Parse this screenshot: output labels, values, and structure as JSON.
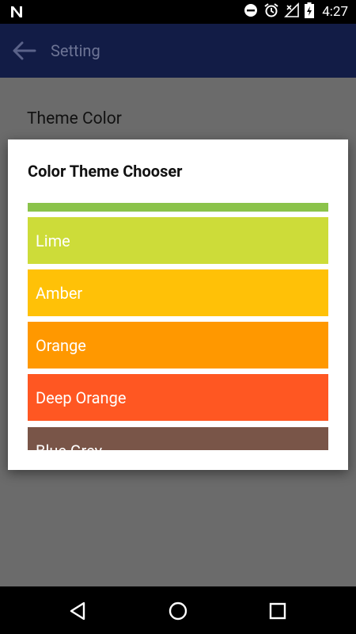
{
  "status_bar": {
    "time": "4:27",
    "icons": [
      "n-notification-icon",
      "do-not-disturb-icon",
      "alarm-icon",
      "signal-icon",
      "battery-charging-icon"
    ]
  },
  "toolbar": {
    "title": "Setting",
    "back_icon": "arrow-back-icon"
  },
  "page": {
    "theme_color_label": "Theme Color"
  },
  "dialog": {
    "title": "Color Theme Chooser",
    "items": [
      {
        "label": "",
        "color": "#8BC34A"
      },
      {
        "label": "Lime",
        "color": "#CDDC39"
      },
      {
        "label": "Amber",
        "color": "#FFC107"
      },
      {
        "label": "Orange",
        "color": "#FF9800"
      },
      {
        "label": "Deep Orange",
        "color": "#FF5722"
      },
      {
        "label": "Blue Grey",
        "color": "#795548"
      }
    ]
  },
  "navigation_bar": {
    "buttons": [
      "back-triangle-icon",
      "home-circle-icon",
      "recents-square-icon"
    ]
  }
}
